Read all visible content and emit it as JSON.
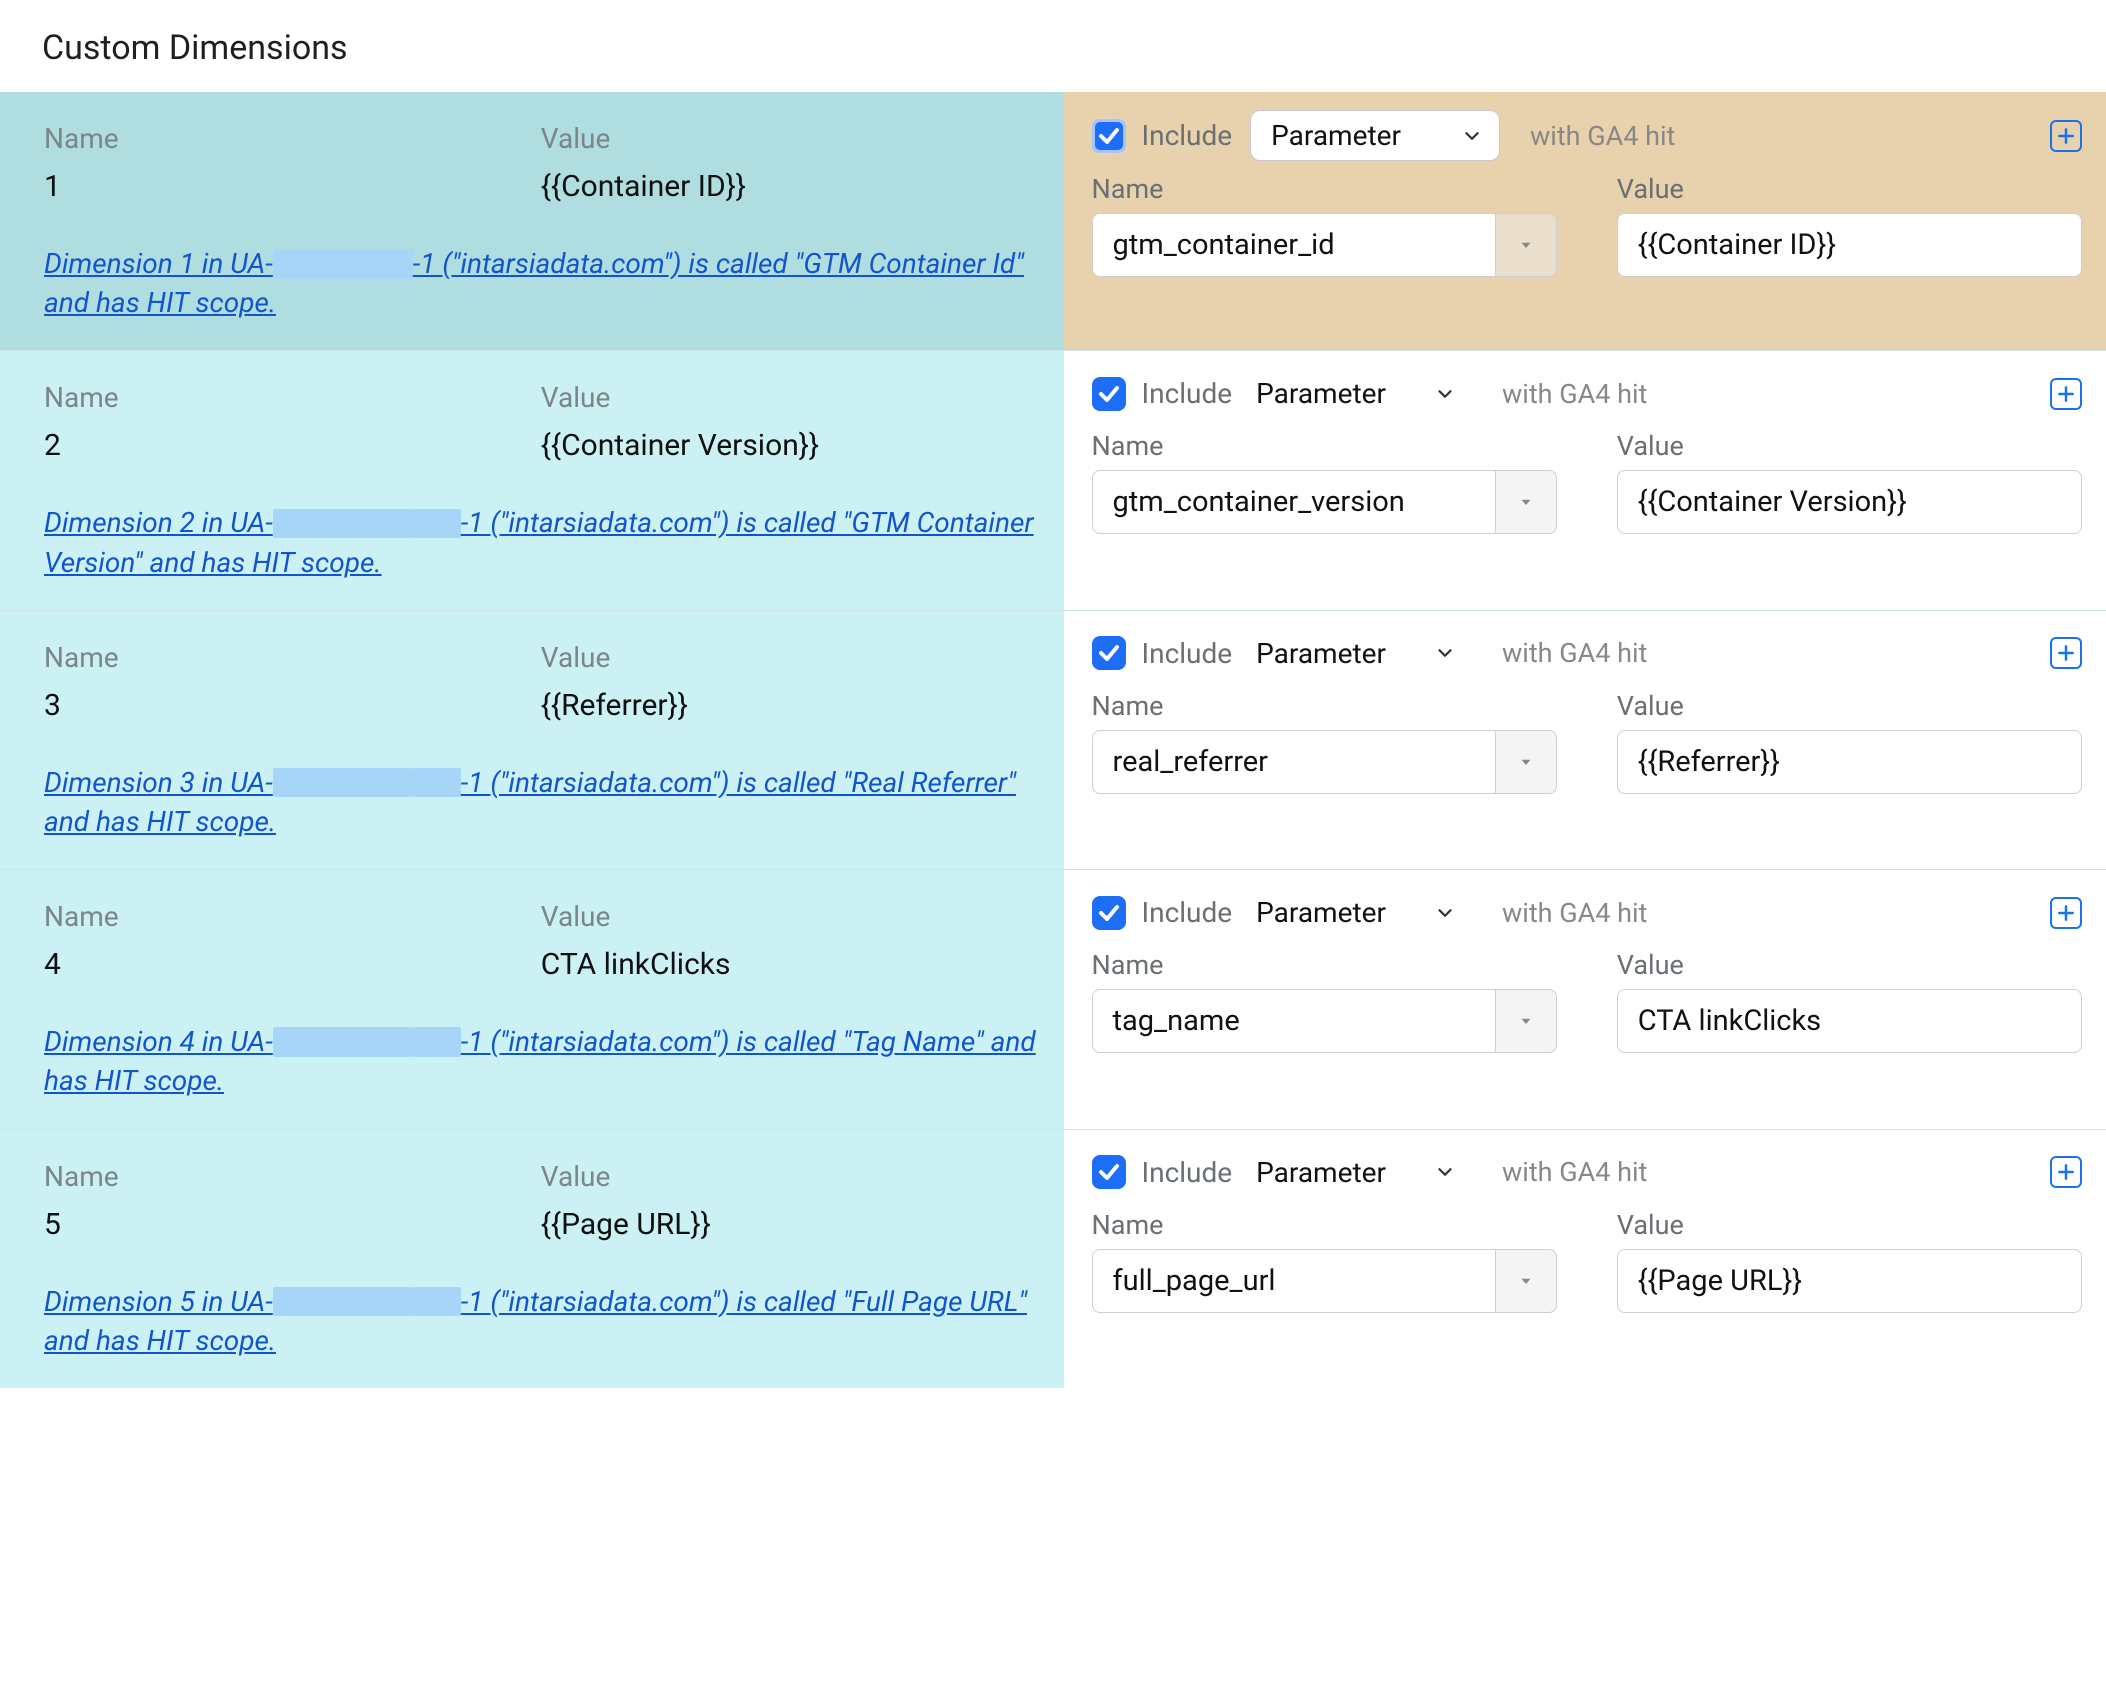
{
  "title": "Custom Dimensions",
  "labels": {
    "name": "Name",
    "value": "Value",
    "include": "Include",
    "with_hit": "with GA4 hit",
    "type_option": "Parameter"
  },
  "rows": [
    {
      "highlight": true,
      "left_name": "1",
      "left_value": "{{Container ID}}",
      "note_parts": [
        "Dimension 1 in UA-",
        "-1 (\"intarsiadata.com\") is called \"GTM Container Id\" and has HIT scope."
      ],
      "param_name": "gtm_container_id",
      "param_value": "{{Container ID}}"
    },
    {
      "highlight": false,
      "left_name": "2",
      "left_value": "{{Container Version}}",
      "note_parts": [
        "Dimension 2 in UA-",
        "-1 (\"intarsiadata.com\") is called \"GTM Container Version\" and has HIT scope."
      ],
      "note_redact2": true,
      "param_name": "gtm_container_version",
      "param_value": "{{Container Version}}"
    },
    {
      "highlight": false,
      "left_name": "3",
      "left_value": "{{Referrer}}",
      "note_parts": [
        "Dimension 3 in UA-",
        "-1 (\"intarsiadata.com\") is called \"Real Referrer\" and has HIT scope."
      ],
      "note_redact2": true,
      "param_name": "real_referrer",
      "param_value": "{{Referrer}}"
    },
    {
      "highlight": false,
      "left_name": "4",
      "left_value": "CTA linkClicks",
      "note_parts": [
        "Dimension 4 in UA-",
        "-1 (\"intarsiadata.com\") is called \"Tag Name\" and has HIT scope."
      ],
      "note_redact2": true,
      "param_name": "tag_name",
      "param_value": "CTA linkClicks"
    },
    {
      "highlight": false,
      "left_name": "5",
      "left_value": "{{Page URL}}",
      "note_parts": [
        "Dimension 5 in UA-",
        "-1 (\"intarsiadata.com\") is called \"Full Page URL\" and has HIT scope."
      ],
      "note_redact2": true,
      "param_name": "full_page_url",
      "param_value": "{{Page URL}}"
    }
  ]
}
